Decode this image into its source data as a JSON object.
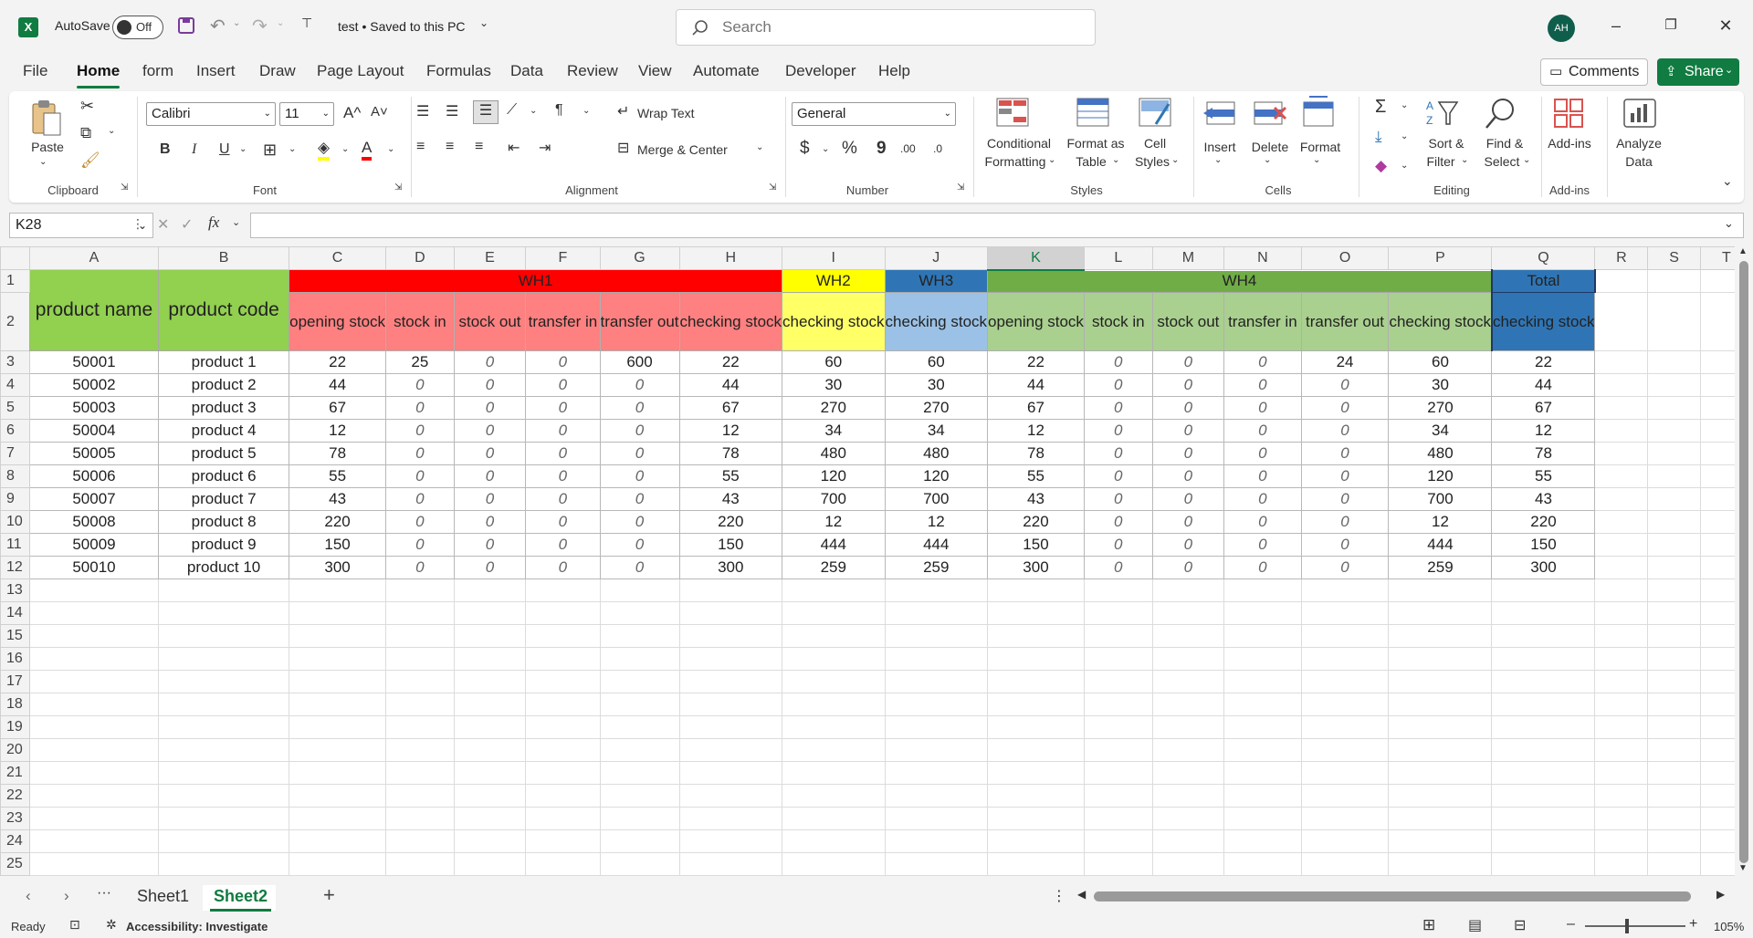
{
  "titlebar": {
    "autosave_label": "AutoSave",
    "autosave_state": "Off",
    "doc_title": "test • Saved to this PC",
    "search_placeholder": "Search",
    "avatar_initials": "AH"
  },
  "menu": {
    "tabs": [
      "File",
      "Home",
      "form",
      "Insert",
      "Draw",
      "Page Layout",
      "Formulas",
      "Data",
      "Review",
      "View",
      "Automate",
      "Developer",
      "Help"
    ],
    "active": "Home",
    "comments_label": "Comments",
    "share_label": "Share"
  },
  "ribbon": {
    "clipboard": {
      "paste": "Paste",
      "group": "Clipboard"
    },
    "font": {
      "name": "Calibri",
      "size": "11",
      "group": "Font",
      "bold": "B",
      "italic": "I",
      "underline": "U",
      "grow": "A^",
      "shrink": "A˅",
      "fontcolor": "A"
    },
    "alignment": {
      "wrap": "Wrap Text",
      "merge": "Merge & Center",
      "group": "Alignment"
    },
    "number": {
      "format": "General",
      "group": "Number",
      "currency": "$",
      "percent": "%",
      "comma": "9",
      "inc_dec": ".00",
      "dec_dec": ".0"
    },
    "styles": {
      "conditional1": "Conditional",
      "conditional2": "Formatting",
      "format_table1": "Format as",
      "format_table2": "Table",
      "cell_styles1": "Cell",
      "cell_styles2": "Styles",
      "group": "Styles"
    },
    "cells": {
      "insert": "Insert",
      "delete": "Delete",
      "format": "Format",
      "group": "Cells"
    },
    "editing": {
      "sort1": "Sort &",
      "sort2": "Filter",
      "find1": "Find &",
      "find2": "Select",
      "group": "Editing",
      "sum": "Σ"
    },
    "addins": {
      "addins": "Add-ins",
      "group": "Add-ins"
    },
    "analyze": {
      "l1": "Analyze",
      "l2": "Data"
    }
  },
  "formula_bar": {
    "name_box": "K28",
    "fx": "fx",
    "formula": ""
  },
  "grid": {
    "columns": [
      "A",
      "B",
      "C",
      "D",
      "E",
      "F",
      "G",
      "H",
      "I",
      "J",
      "K",
      "L",
      "M",
      "N",
      "O",
      "P",
      "Q",
      "R",
      "S",
      "T"
    ],
    "selected_column": "K",
    "row_numbers": [
      "1",
      "2",
      "3",
      "4",
      "5",
      "6",
      "7",
      "8",
      "9",
      "10",
      "11",
      "12",
      "13",
      "14",
      "15",
      "16",
      "17",
      "18",
      "19",
      "20",
      "21",
      "22",
      "23",
      "24",
      "25"
    ],
    "row1": {
      "product_name": "product name",
      "product_code": "product code",
      "wh1": "WH1",
      "wh2": "WH2",
      "wh3": "WH3",
      "wh4": "WH4",
      "total": "Total"
    },
    "row2": [
      "opening stock",
      "stock in",
      "stock out",
      "transfer in",
      "transfer out",
      "checking stock",
      "checking stock",
      "checking stock",
      "opening stock",
      "stock in",
      "stock out",
      "transfer in",
      "transfer out",
      "checking stock",
      "checking stock"
    ],
    "rows": [
      [
        "50001",
        "product 1",
        "22",
        "25",
        "0",
        "0",
        "600",
        "22",
        "60",
        "60",
        "22",
        "0",
        "0",
        "0",
        "24",
        "60",
        "22"
      ],
      [
        "50002",
        "product 2",
        "44",
        "0",
        "0",
        "0",
        "0",
        "44",
        "30",
        "30",
        "44",
        "0",
        "0",
        "0",
        "0",
        "30",
        "44"
      ],
      [
        "50003",
        "product 3",
        "67",
        "0",
        "0",
        "0",
        "0",
        "67",
        "270",
        "270",
        "67",
        "0",
        "0",
        "0",
        "0",
        "270",
        "67"
      ],
      [
        "50004",
        "product 4",
        "12",
        "0",
        "0",
        "0",
        "0",
        "12",
        "34",
        "34",
        "12",
        "0",
        "0",
        "0",
        "0",
        "34",
        "12"
      ],
      [
        "50005",
        "product 5",
        "78",
        "0",
        "0",
        "0",
        "0",
        "78",
        "480",
        "480",
        "78",
        "0",
        "0",
        "0",
        "0",
        "480",
        "78"
      ],
      [
        "50006",
        "product 6",
        "55",
        "0",
        "0",
        "0",
        "0",
        "55",
        "120",
        "120",
        "55",
        "0",
        "0",
        "0",
        "0",
        "120",
        "55"
      ],
      [
        "50007",
        "product 7",
        "43",
        "0",
        "0",
        "0",
        "0",
        "43",
        "700",
        "700",
        "43",
        "0",
        "0",
        "0",
        "0",
        "700",
        "43"
      ],
      [
        "50008",
        "product 8",
        "220",
        "0",
        "0",
        "0",
        "0",
        "220",
        "12",
        "12",
        "220",
        "0",
        "0",
        "0",
        "0",
        "12",
        "220"
      ],
      [
        "50009",
        "product 9",
        "150",
        "0",
        "0",
        "0",
        "0",
        "150",
        "444",
        "444",
        "150",
        "0",
        "0",
        "0",
        "0",
        "444",
        "150"
      ],
      [
        "50010",
        "product 10",
        "300",
        "0",
        "0",
        "0",
        "0",
        "300",
        "259",
        "259",
        "300",
        "0",
        "0",
        "0",
        "0",
        "259",
        "300"
      ]
    ]
  },
  "sheets": {
    "tabs": [
      "Sheet1",
      "Sheet2"
    ],
    "active": "Sheet2",
    "more": "···",
    "add": "+"
  },
  "status": {
    "ready": "Ready",
    "accessibility": "Accessibility: Investigate",
    "zoom": "105%"
  },
  "colors": {
    "excel_green": "#107c41",
    "header_green": "#92d050",
    "wh1_red": "#ff0000",
    "wh1_sub": "#ff8080",
    "wh2_yellow": "#ffff00",
    "wh2_sub": "#ffff66",
    "wh3_blue": "#2f75b5",
    "wh3_sub": "#9bc2e6",
    "wh4_green": "#70ad47",
    "wh4_sub": "#a9d08e",
    "total_blue": "#2f75b5"
  }
}
